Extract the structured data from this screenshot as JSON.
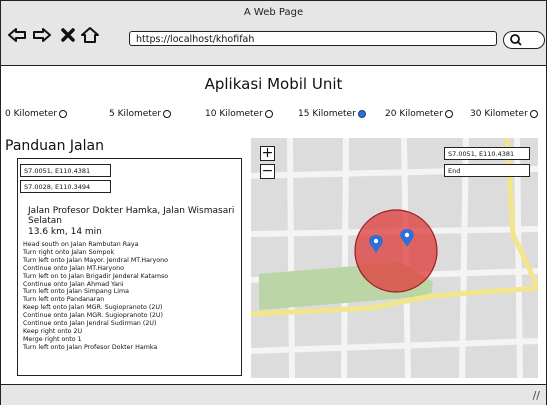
{
  "window": {
    "title": "A Web Page",
    "url": "https://localhost/khofifah"
  },
  "app": {
    "title": "Aplikasi Mobil Unit"
  },
  "radius_options": [
    {
      "label": "0 Kilometer",
      "selected": false
    },
    {
      "label": "5 Kilometer",
      "selected": false
    },
    {
      "label": "10 Kilometer",
      "selected": false
    },
    {
      "label": "15 Kilometer",
      "selected": true
    },
    {
      "label": "20 Kilometer",
      "selected": false
    },
    {
      "label": "30 Kilometer",
      "selected": false
    }
  ],
  "guide": {
    "title": "Panduan Jalan",
    "start_coord": "S7.0051, E110.4381",
    "end_coord": "S7.0028, E110.3494",
    "destination": "Jalan Profesor Dokter Hamka, Jalan Wismasari Selatan",
    "summary": "13.6 km, 14 min",
    "steps": [
      "Head south on Jalan Rambutan Raya",
      "Turn right onto Jalan Sompok",
      "Turn left onto Jalan Mayor. Jendral MT.Haryono",
      "Continue onto Jalan MT.Haryono",
      "Turn left on to Jalan Brigadir Jenderal Katamso",
      "Continue onto Jalan Ahmad Yani",
      "Turn left onto Jalan Simpang Lima",
      "Turn left onto Pandanaran",
      "Keep left onto Jalan MGR. Sugiopranoto (2U)",
      "Continue onto Jalan MGR. Sugiopranoto (2U)",
      "Continue onto Jalan Jendral Sudirman (2U)",
      "Keep right onto 2U",
      "Merge right onto 1",
      "Turn left onto Jalan Profesor Dokter Hamka"
    ]
  },
  "map": {
    "start_input": "S7.0051, E110.4381",
    "end_input": "End",
    "zoom_in": "+",
    "zoom_out": "−",
    "radius_color": "#e03a3a",
    "marker_color": "#2f6fd6"
  },
  "icons": [
    "back-arrow-icon",
    "forward-arrow-icon",
    "close-x-icon",
    "home-icon",
    "search-icon",
    "resize-grip-icon",
    "map-marker-icon"
  ]
}
